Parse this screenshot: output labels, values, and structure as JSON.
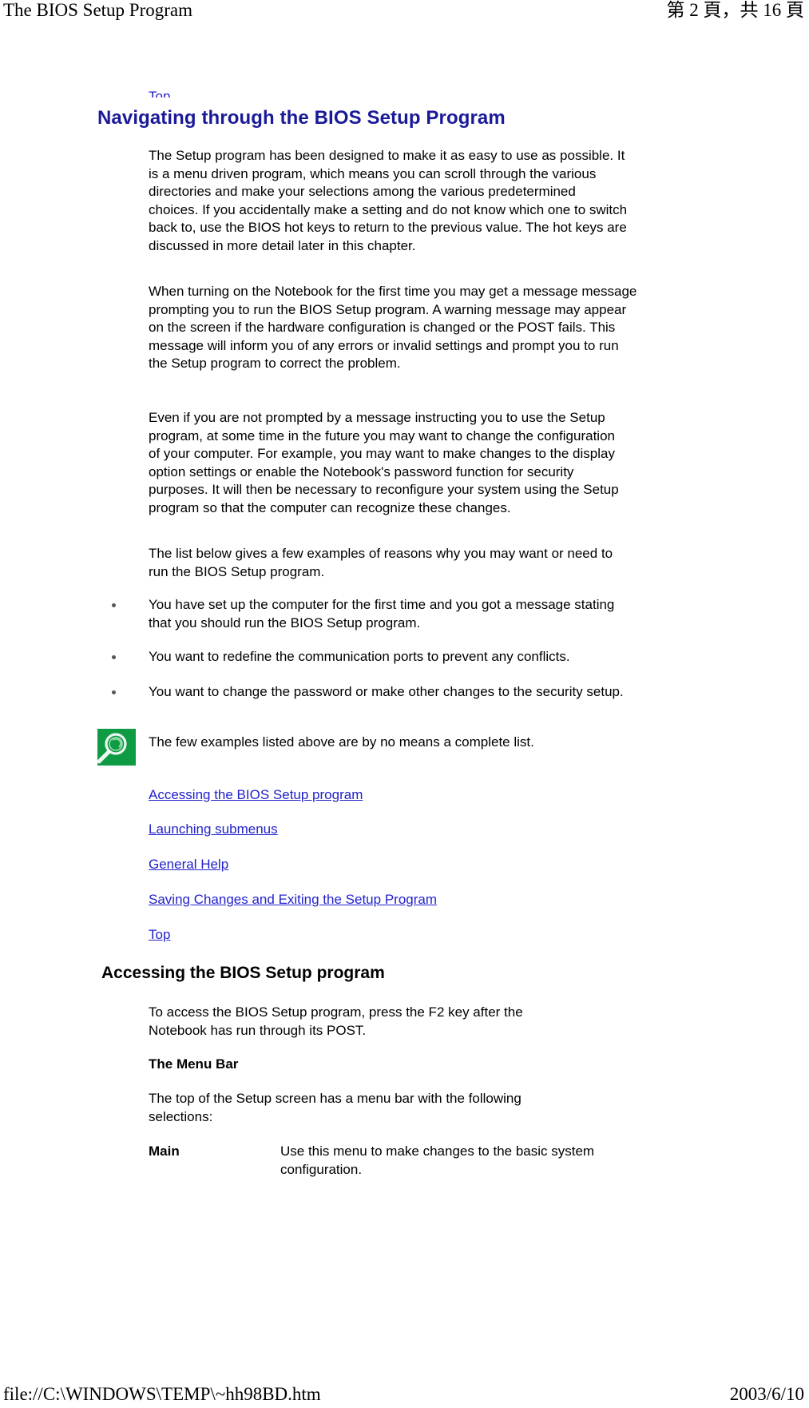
{
  "print": {
    "header_left": "The BIOS Setup Program",
    "header_right": "第 2 頁，共 16 頁",
    "footer_left": "file://C:\\WINDOWS\\TEMP\\~hh98BD.htm",
    "footer_right": "2003/6/10"
  },
  "colors": {
    "link": "#2222cc",
    "title": "#1a1a99",
    "note_icon_bg": "#0f9b43",
    "bullet": "#555555",
    "text": "#000000",
    "background": "#ffffff"
  },
  "clipped_top_link": "Top",
  "page_title": "Navigating through the BIOS Setup Program",
  "paragraphs": [
    "The Setup program has been designed to make it as easy to use as possible. It is a menu driven program, which means you can scroll through the various directories and make your selections among the various predetermined choices. If you accidentally make a setting and do not know which one to switch back to, use the BIOS hot keys to return to the previous value. The hot keys are discussed in more detail later in this chapter.",
    "When turning on the Notebook for the first time you may get a message message prompting you to run the BIOS Setup program. A warning message may appear on the screen if the hardware configuration is changed or the POST fails. This message will inform you of any errors or invalid settings and prompt you to run the Setup program to correct the problem.",
    "Even if you are not prompted by a message instructing you to use the Setup program, at some time in the future you may want to change the configuration of your computer. For example, you may want to make changes to the display option settings or enable the Notebook's password function for security purposes. It will then be necessary to reconfigure your system using the Setup program so that the computer can recognize these changes.",
    "The list below gives a few examples of reasons why you may want or need to run the BIOS Setup program."
  ],
  "bullets": [
    "You have set up the computer for the first time and you got a message stating that you should run the BIOS Setup program.",
    "You want to redefine the communication ports to prevent any conflicts.",
    "You want to change the password or make other changes to the security setup."
  ],
  "note": {
    "icon": "magnifier-icon",
    "text": "The few examples listed above are by no means a complete list."
  },
  "toc_links": [
    "Accessing the BIOS Setup program",
    "Launching submenus",
    "General Help",
    "Saving Changes and Exiting the Setup Program",
    "Top"
  ],
  "accessing_section": {
    "heading": "Accessing the BIOS Setup program",
    "paragraph": "To access the BIOS Setup program, press the F2 key after the Notebook has run through its POST.",
    "sub_heading": "The Menu Bar",
    "sub_paragraph": "The top of the Setup screen has a menu bar with the following selections:",
    "definitions": [
      {
        "term": "Main",
        "desc": "Use this menu to make changes to the basic system configuration."
      }
    ]
  }
}
